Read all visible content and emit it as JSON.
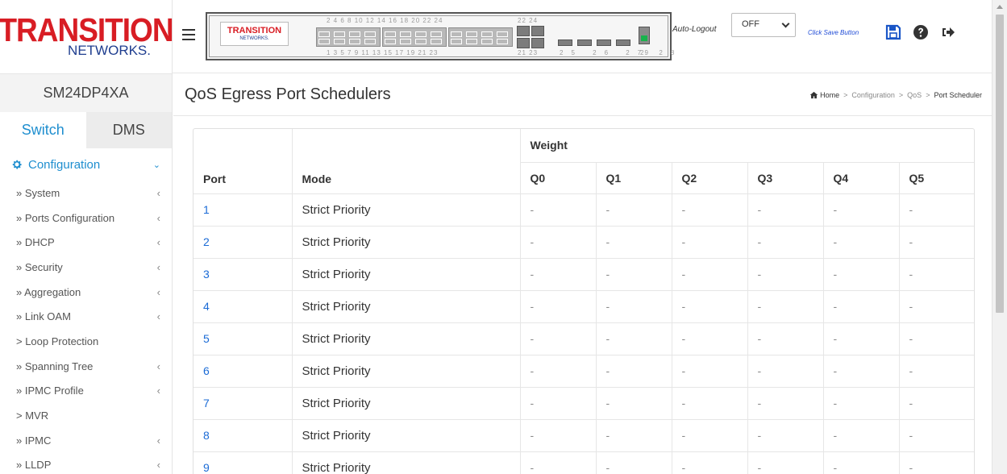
{
  "brand": {
    "logo_main": "TRANSITION",
    "logo_sub": "NETWORKS.",
    "accent": "#1e8ecf",
    "logo_red": "#d81d24",
    "logo_blue": "#1f3e8f"
  },
  "device": {
    "name": "SM24DP4XA"
  },
  "tabs": [
    {
      "label": "Switch",
      "active": true
    },
    {
      "label": "DMS",
      "active": false
    }
  ],
  "menu": {
    "section": {
      "label": "Configuration",
      "icon": "gear-icon",
      "expanded": true
    },
    "items": [
      {
        "label": "» System",
        "has_submenu": true
      },
      {
        "label": "» Ports Configuration",
        "has_submenu": true
      },
      {
        "label": "» DHCP",
        "has_submenu": true
      },
      {
        "label": "» Security",
        "has_submenu": true
      },
      {
        "label": "» Aggregation",
        "has_submenu": true
      },
      {
        "label": "» Link OAM",
        "has_submenu": true
      },
      {
        "label": "> Loop Protection",
        "has_submenu": false
      },
      {
        "label": "» Spanning Tree",
        "has_submenu": true
      },
      {
        "label": "» IPMC Profile",
        "has_submenu": true
      },
      {
        "label": "> MVR",
        "has_submenu": false
      },
      {
        "label": "» IPMC",
        "has_submenu": true
      },
      {
        "label": "» LLDP",
        "has_submenu": true
      }
    ]
  },
  "topbar": {
    "panel_logo_main": "TRANSITION",
    "panel_logo_sub": "NETWORKS.",
    "ports_top_label": "2 4 6 8 10 12 14 16 18 20 22 24",
    "ports_bottom_label": "1 3 5 7 9 11 13 15 17 19 21 23",
    "sfp_top_label": "22 24",
    "sfp_bottom_label": "21 23",
    "uplink_label": "25 26 27 28",
    "mgmt_label": "29",
    "auto_logout_label": "Auto-Logout",
    "auto_logout_value": "OFF",
    "save_hint": "Click Save Button",
    "icons": [
      "save-icon",
      "help-icon",
      "logout-icon"
    ]
  },
  "page": {
    "title": "QoS Egress Port Schedulers",
    "breadcrumb": [
      "Home",
      "Configuration",
      "QoS",
      "Port Scheduler"
    ]
  },
  "table": {
    "headers": {
      "port": "Port",
      "mode": "Mode",
      "weight": "Weight"
    },
    "queues": [
      "Q0",
      "Q1",
      "Q2",
      "Q3",
      "Q4",
      "Q5"
    ],
    "rows": [
      {
        "port": "1",
        "mode": "Strict Priority",
        "weights": [
          "-",
          "-",
          "-",
          "-",
          "-",
          "-"
        ]
      },
      {
        "port": "2",
        "mode": "Strict Priority",
        "weights": [
          "-",
          "-",
          "-",
          "-",
          "-",
          "-"
        ]
      },
      {
        "port": "3",
        "mode": "Strict Priority",
        "weights": [
          "-",
          "-",
          "-",
          "-",
          "-",
          "-"
        ]
      },
      {
        "port": "4",
        "mode": "Strict Priority",
        "weights": [
          "-",
          "-",
          "-",
          "-",
          "-",
          "-"
        ]
      },
      {
        "port": "5",
        "mode": "Strict Priority",
        "weights": [
          "-",
          "-",
          "-",
          "-",
          "-",
          "-"
        ]
      },
      {
        "port": "6",
        "mode": "Strict Priority",
        "weights": [
          "-",
          "-",
          "-",
          "-",
          "-",
          "-"
        ]
      },
      {
        "port": "7",
        "mode": "Strict Priority",
        "weights": [
          "-",
          "-",
          "-",
          "-",
          "-",
          "-"
        ]
      },
      {
        "port": "8",
        "mode": "Strict Priority",
        "weights": [
          "-",
          "-",
          "-",
          "-",
          "-",
          "-"
        ]
      },
      {
        "port": "9",
        "mode": "Strict Priority",
        "weights": [
          "-",
          "-",
          "-",
          "-",
          "-",
          "-"
        ]
      }
    ]
  }
}
